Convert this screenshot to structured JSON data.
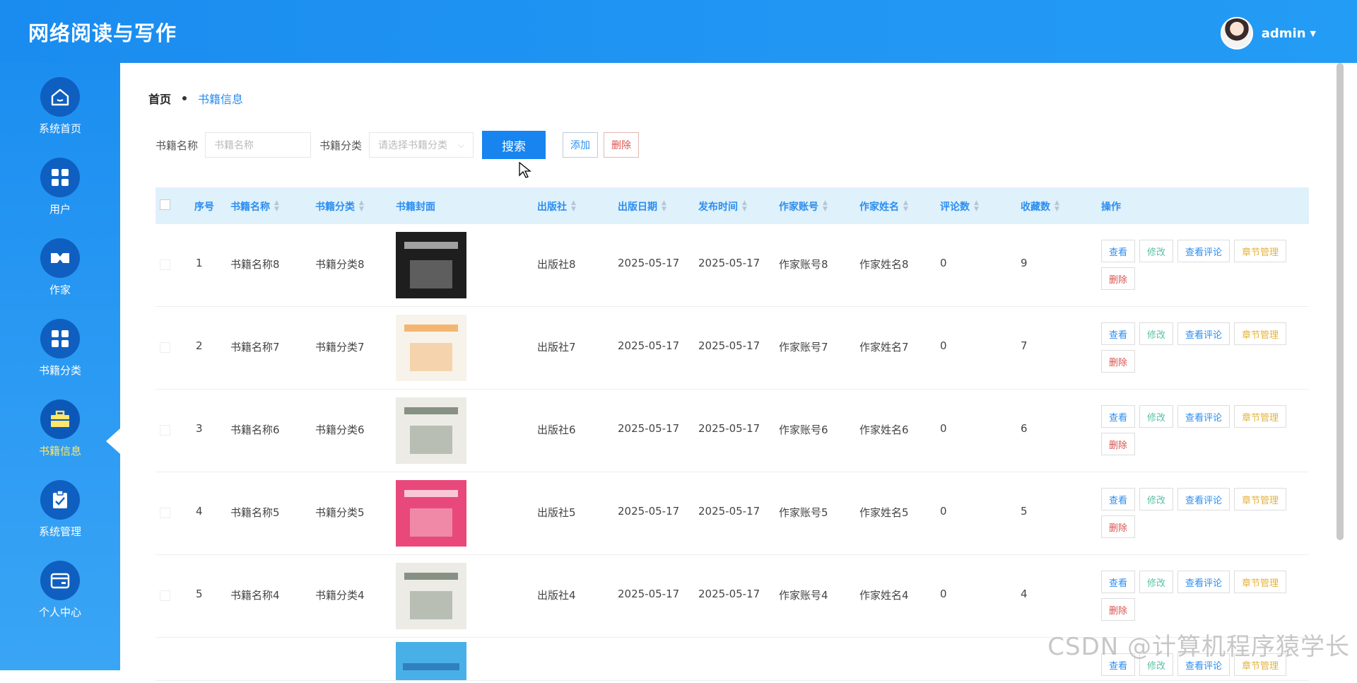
{
  "header": {
    "title": "网络阅读与写作",
    "username": "admin"
  },
  "sidebar": {
    "items": [
      {
        "label": "系统首页",
        "icon": "home-icon"
      },
      {
        "label": "用户",
        "icon": "grid-icon"
      },
      {
        "label": "作家",
        "icon": "pen-icon"
      },
      {
        "label": "书籍分类",
        "icon": "grid-icon"
      },
      {
        "label": "书籍信息",
        "icon": "briefcase-icon",
        "active": true
      },
      {
        "label": "系统管理",
        "icon": "clipboard-check-icon"
      },
      {
        "label": "个人中心",
        "icon": "wallet-icon"
      }
    ]
  },
  "breadcrumb": {
    "home": "首页",
    "current": "书籍信息"
  },
  "search": {
    "name_label": "书籍名称",
    "name_placeholder": "书籍名称",
    "category_label": "书籍分类",
    "category_placeholder": "请选择书籍分类",
    "search_button": "搜索",
    "add_button": "添加",
    "delete_button": "删除"
  },
  "table": {
    "headers": [
      "序号",
      "书籍名称",
      "书籍分类",
      "书籍封面",
      "出版社",
      "出版日期",
      "发布时间",
      "作家账号",
      "作家姓名",
      "评论数",
      "收藏数",
      "操作"
    ],
    "actions": {
      "view": "查看",
      "edit": "修改",
      "comments": "查看评论",
      "chapters": "章节管理",
      "delete": "删除"
    },
    "rows": [
      {
        "no": "1",
        "name": "书籍名称8",
        "category": "书籍分类8",
        "publisher": "出版社8",
        "pub_date": "2025-05-17",
        "release": "2025-05-17",
        "account": "作家账号8",
        "author": "作家姓名8",
        "comments": "0",
        "favorites": "9"
      },
      {
        "no": "2",
        "name": "书籍名称7",
        "category": "书籍分类7",
        "publisher": "出版社7",
        "pub_date": "2025-05-17",
        "release": "2025-05-17",
        "account": "作家账号7",
        "author": "作家姓名7",
        "comments": "0",
        "favorites": "7"
      },
      {
        "no": "3",
        "name": "书籍名称6",
        "category": "书籍分类6",
        "publisher": "出版社6",
        "pub_date": "2025-05-17",
        "release": "2025-05-17",
        "account": "作家账号6",
        "author": "作家姓名6",
        "comments": "0",
        "favorites": "6"
      },
      {
        "no": "4",
        "name": "书籍名称5",
        "category": "书籍分类5",
        "publisher": "出版社5",
        "pub_date": "2025-05-17",
        "release": "2025-05-17",
        "account": "作家账号5",
        "author": "作家姓名5",
        "comments": "0",
        "favorites": "5"
      },
      {
        "no": "5",
        "name": "书籍名称4",
        "category": "书籍分类4",
        "publisher": "出版社4",
        "pub_date": "2025-05-17",
        "release": "2025-05-17",
        "account": "作家账号4",
        "author": "作家姓名4",
        "comments": "0",
        "favorites": "4"
      }
    ]
  },
  "covers": [
    {
      "bg": "#1e1e1e",
      "accent": "#d8d8d8"
    },
    {
      "bg": "#f7f3ea",
      "accent": "#f29a3c"
    },
    {
      "bg": "#ecebe6",
      "accent": "#5b6b5a"
    },
    {
      "bg": "#e8497a",
      "accent": "#ffffff"
    },
    {
      "bg": "#ecebe6",
      "accent": "#5b6b5a"
    },
    {
      "bg": "#48b0e6",
      "accent": "#1f5fa8"
    }
  ],
  "watermark": "CSDN @计算机程序猿学长",
  "colors": {
    "primary": "#1784ef",
    "header_bg": "#2196f3",
    "active_label": "#ffe66b"
  }
}
